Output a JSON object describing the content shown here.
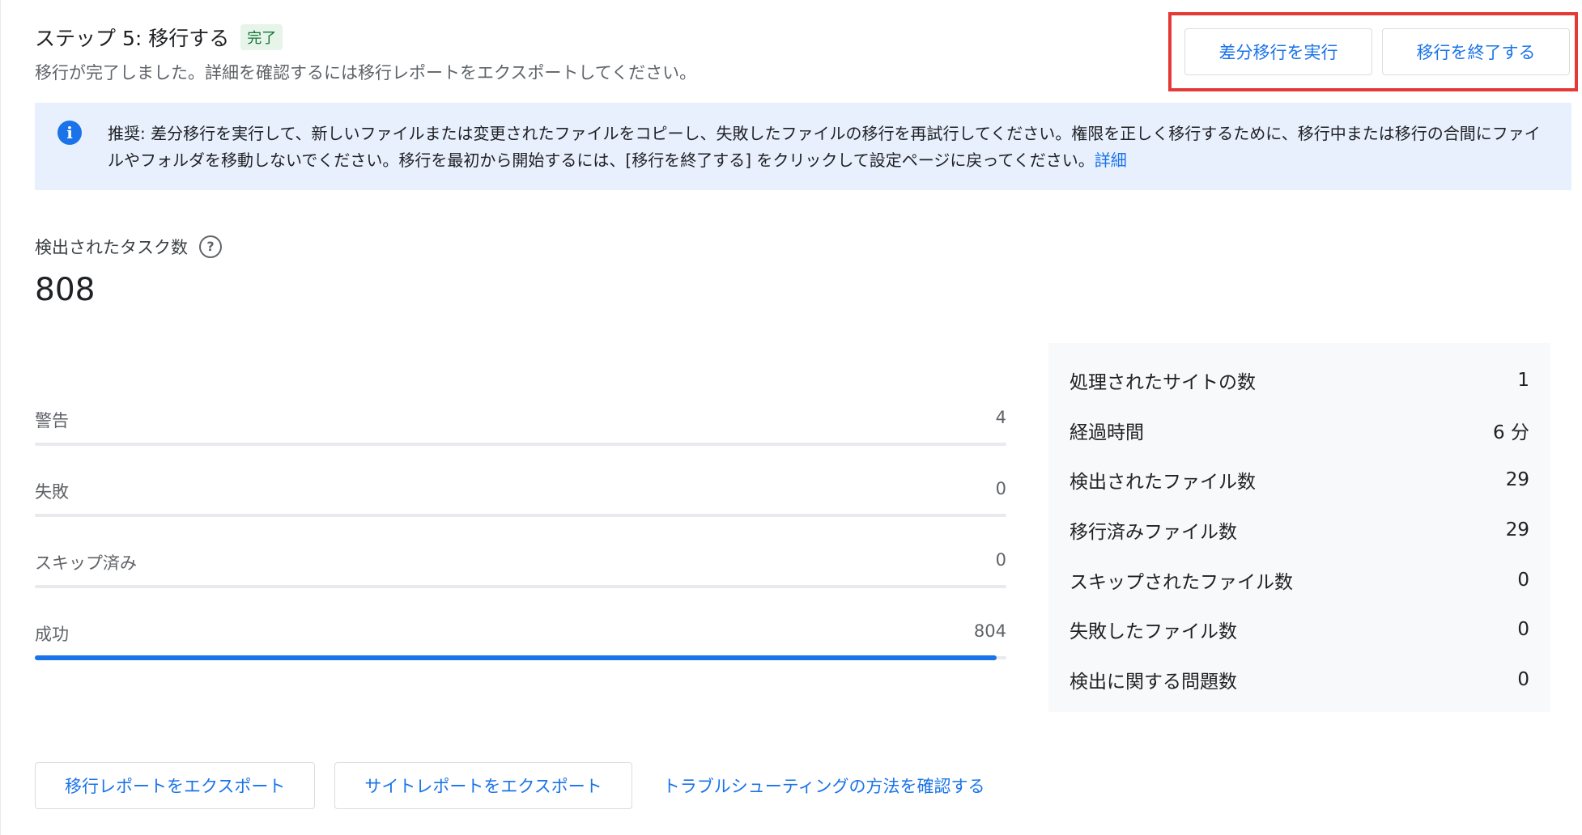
{
  "header": {
    "title": "ステップ 5: 移行する",
    "status_badge": "完了",
    "subtitle": "移行が完了しました。詳細を確認するには移行レポートをエクスポートしてください。",
    "delta_migration_button": "差分移行を実行",
    "finish_migration_button": "移行を終了する"
  },
  "info_banner": {
    "icon": "info-icon",
    "text": "推奨: 差分移行を実行して、新しいファイルまたは変更されたファイルをコピーし、失敗したファイルの移行を再試行してください。権限を正しく移行するために、移行中または移行の合間にファイルやフォルダを移動しないでください。移行を最初から開始するには、[移行を終了する] をクリックして設定ページに戻ってください。",
    "link": "詳細"
  },
  "tasks": {
    "label": "検出されたタスク数",
    "help_icon": "help-circle-icon",
    "count": "808"
  },
  "bars": {
    "items": [
      {
        "label": "警告",
        "value": "4",
        "fraction": 0
      },
      {
        "label": "失敗",
        "value": "0",
        "fraction": 0
      },
      {
        "label": "スキップ済み",
        "value": "0",
        "fraction": 0
      },
      {
        "label": "成功",
        "value": "804",
        "fraction": 0.99
      }
    ],
    "fill_color": "#1a73e8"
  },
  "stats": {
    "items": [
      {
        "label": "処理されたサイトの数",
        "value": "1"
      },
      {
        "label": "経過時間",
        "value": "6 分"
      },
      {
        "label": "検出されたファイル数",
        "value": "29"
      },
      {
        "label": "移行済みファイル数",
        "value": "29"
      },
      {
        "label": "スキップされたファイル数",
        "value": "0"
      },
      {
        "label": "失敗したファイル数",
        "value": "0"
      },
      {
        "label": "検出に関する問題数",
        "value": "0"
      }
    ]
  },
  "footer": {
    "export_migration_report": "移行レポートをエクスポート",
    "export_site_report": "サイトレポートをエクスポート",
    "troubleshooting_link": "トラブルシューティングの方法を確認する"
  },
  "colors": {
    "accent": "#1a73e8",
    "highlight_border": "#e53935",
    "badge_bg": "#e6f4ea",
    "badge_text": "#137333",
    "banner_bg": "#e8f0fe"
  }
}
